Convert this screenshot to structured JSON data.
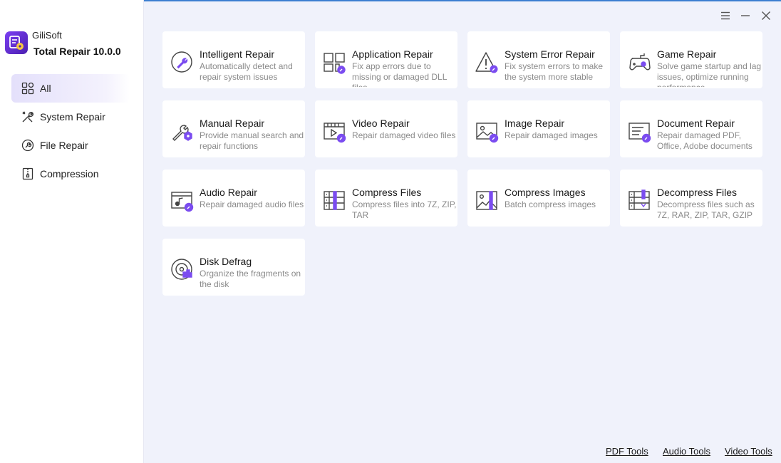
{
  "app": {
    "company": "GiliSoft",
    "product": "Total Repair 10.0.0"
  },
  "sidebar": {
    "items": [
      {
        "label": "All",
        "icon": "grid-icon",
        "active": true
      },
      {
        "label": "System Repair",
        "icon": "tools-icon",
        "active": false
      },
      {
        "label": "File Repair",
        "icon": "file-repair-icon",
        "active": false
      },
      {
        "label": "Compression",
        "icon": "compression-icon",
        "active": false
      }
    ]
  },
  "window_controls": [
    "menu-icon",
    "minimize-icon",
    "close-icon"
  ],
  "tools": [
    {
      "title": "Intelligent Repair",
      "desc": "Automatically detect and repair system issues",
      "icon": "wrench-circle-icon"
    },
    {
      "title": "Application Repair",
      "desc": "Fix app errors due to missing or damaged DLL files",
      "icon": "app-grid-icon"
    },
    {
      "title": "System Error Repair",
      "desc": "Fix system errors to make the system more stable",
      "icon": "warning-icon"
    },
    {
      "title": "Game Repair",
      "desc": "Solve game startup and lag issues, optimize running performance",
      "icon": "gamepad-icon"
    },
    {
      "title": "Manual Repair",
      "desc": "Provide manual search and repair functions",
      "icon": "wrench-gear-icon"
    },
    {
      "title": "Video Repair",
      "desc": "Repair damaged video files",
      "icon": "video-icon"
    },
    {
      "title": "Image Repair",
      "desc": "Repair damaged images",
      "icon": "image-icon"
    },
    {
      "title": "Document Repair",
      "desc": "Repair damaged PDF, Office, Adobe documents",
      "icon": "document-icon"
    },
    {
      "title": "Audio Repair",
      "desc": "Repair damaged audio files",
      "icon": "audio-icon"
    },
    {
      "title": "Compress Files",
      "desc": "Compress files into 7Z, ZIP, TAR",
      "icon": "compress-files-icon"
    },
    {
      "title": "Compress Images",
      "desc": "Batch compress images",
      "icon": "compress-images-icon"
    },
    {
      "title": "Decompress Files",
      "desc": "Decompress files such as 7Z, RAR, ZIP, TAR, GZIP",
      "icon": "decompress-files-icon"
    },
    {
      "title": "Disk Defrag",
      "desc": "Organize the fragments on the disk",
      "icon": "disk-icon"
    }
  ],
  "footer": {
    "pdf_tools": "PDF Tools",
    "audio_tools": "Audio Tools",
    "video_tools": "Video Tools"
  },
  "colors": {
    "accent": "#7b4cf0",
    "background": "#f0f2fb",
    "card": "#ffffff",
    "sidebar": "#ffffff"
  }
}
